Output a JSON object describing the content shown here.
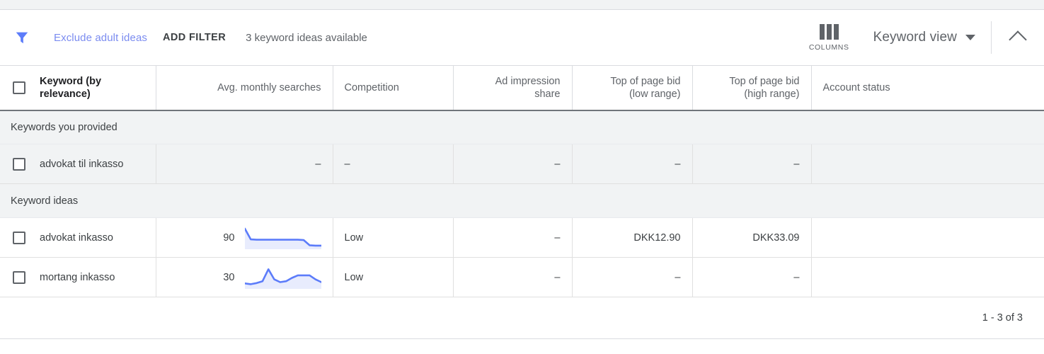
{
  "toolbar": {
    "filter_icon": "funnel-icon",
    "exclude_adult_ideas": "Exclude adult ideas",
    "add_filter": "ADD FILTER",
    "ideas_available": "3 keyword ideas available",
    "columns_label": "COLUMNS",
    "columns_icon": "columns-icon",
    "view_label": "Keyword view",
    "caret_icon": "chevron-down-icon",
    "collapse_icon": "chevron-up-icon"
  },
  "table": {
    "columns": [
      {
        "label": "Keyword (by relevance)",
        "align": "left"
      },
      {
        "label": "Avg. monthly searches",
        "align": "right"
      },
      {
        "label": "Competition",
        "align": "left"
      },
      {
        "label": "Ad impression share",
        "align": "right"
      },
      {
        "label": "Top of page bid (low range)",
        "align": "right"
      },
      {
        "label": "Top of page bid (high range)",
        "align": "right"
      },
      {
        "label": "Account status",
        "align": "left"
      }
    ],
    "column_lines": [
      [
        "Keyword (by",
        "relevance)"
      ],
      [
        "Avg. monthly searches"
      ],
      [
        "Competition"
      ],
      [
        "Ad impression",
        "share"
      ],
      [
        "Top of page bid",
        "(low range)"
      ],
      [
        "Top of page bid",
        "(high range)"
      ],
      [
        "Account status"
      ]
    ],
    "groups": [
      {
        "title": "Keywords you provided",
        "rows": [
          {
            "keyword": "advokat til inkasso",
            "avg_monthly_searches": "–",
            "sparkline": null,
            "competition": "–",
            "ad_impression_share": "–",
            "top_bid_low": "–",
            "top_bid_high": "–",
            "account_status": "",
            "shaded": true
          }
        ]
      },
      {
        "title": "Keyword ideas",
        "rows": [
          {
            "keyword": "advokat inkasso",
            "avg_monthly_searches": "90",
            "sparkline": [
              100,
              42,
              40,
              40,
              40,
              40,
              40,
              40,
              40,
              40,
              38,
              10,
              8,
              8
            ],
            "competition": "Low",
            "ad_impression_share": "–",
            "top_bid_low": "DKK12.90",
            "top_bid_high": "DKK33.09",
            "account_status": "",
            "shaded": false
          },
          {
            "keyword": "mortang inkasso",
            "avg_monthly_searches": "30",
            "sparkline": [
              18,
              14,
              20,
              30,
              95,
              40,
              25,
              30,
              48,
              62,
              62,
              62,
              40,
              25
            ],
            "competition": "Low",
            "ad_impression_share": "–",
            "top_bid_low": "–",
            "top_bid_high": "–",
            "account_status": "",
            "shaded": false
          }
        ]
      }
    ]
  },
  "footer": {
    "pagination": "1 - 3 of 3"
  },
  "colors": {
    "link": "#7b8cf0",
    "sparkline_stroke": "#5c7cfa",
    "sparkline_fill": "#e8ecfd",
    "header_rule": "#70757a",
    "row_shade": "#f1f3f4"
  }
}
